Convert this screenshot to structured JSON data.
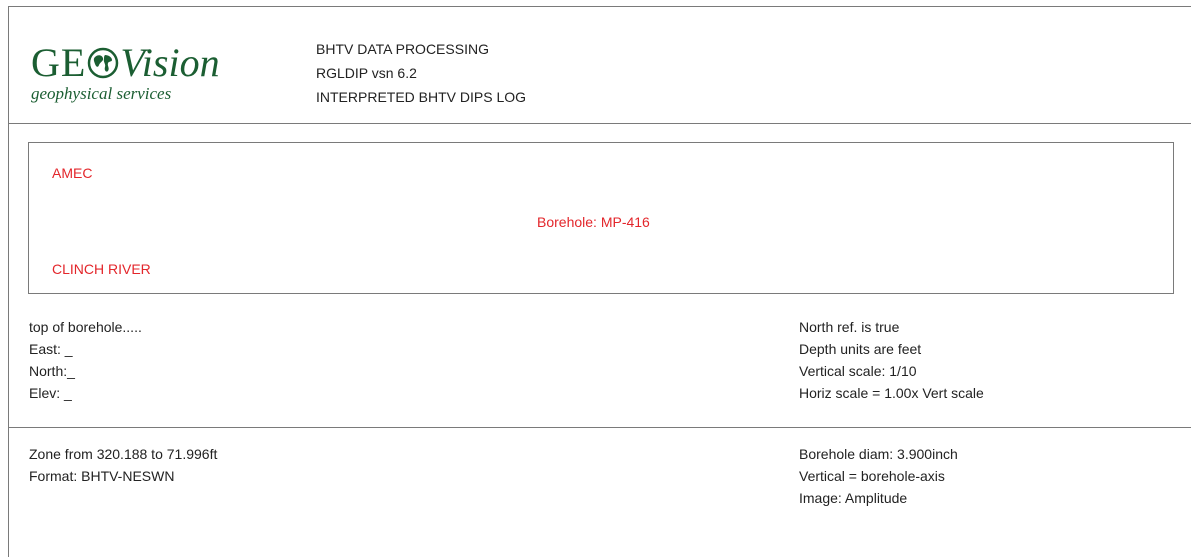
{
  "logo": {
    "brand_prefix": "GE",
    "brand_suffix": "Vision",
    "tagline": "geophysical services",
    "globe_icon": "globe-icon",
    "brand_color": "#1b5e32"
  },
  "header": {
    "line1": "BHTV DATA PROCESSING",
    "line2": "RGLDIP vsn 6.2",
    "line3": "INTERPRETED BHTV DIPS LOG"
  },
  "project": {
    "company": "AMEC",
    "borehole": "Borehole: MP-416",
    "location": "CLINCH RIVER",
    "accent_color": "#e3262b"
  },
  "position": {
    "top_label": "top of borehole.....",
    "east": "East: _",
    "north": "North:_",
    "elev": "Elev: _"
  },
  "settings": {
    "north_ref": "North ref. is true",
    "depth_units": "Depth units are feet",
    "vertical_scale": "Vertical scale: 1/10",
    "horiz_scale": "Horiz scale = 1.00x Vert scale"
  },
  "zone": {
    "range": "Zone from 320.188 to 71.996ft",
    "format": "Format: BHTV-NESWN",
    "diam": "Borehole diam: 3.900inch",
    "vertical": "Vertical = borehole-axis",
    "image": "Image: Amplitude"
  }
}
